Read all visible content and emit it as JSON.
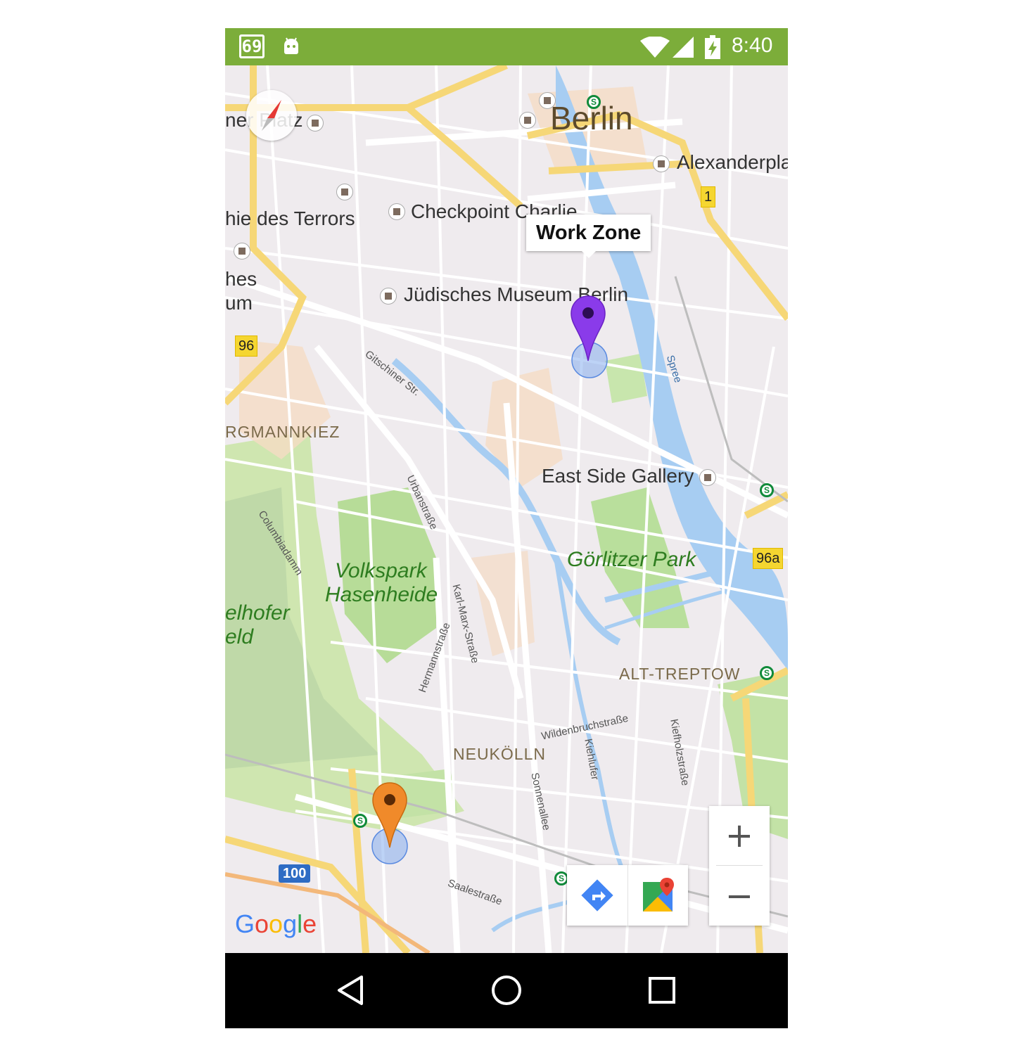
{
  "status_bar": {
    "notification_number": "69",
    "time": "8:40",
    "color": "#7cad3a"
  },
  "map": {
    "city_label": "Berlin",
    "poi_labels": {
      "alexanderplatz": "Alexanderpla",
      "checkpoint_charlie": "Checkpoint Charlie",
      "topographie": "hie des Terrors",
      "juedisches_museum": "Jüdisches Museum Berlin",
      "east_side_gallery": "East Side Gallery",
      "platz": "ner Platz",
      "hes": "hes",
      "um": "um"
    },
    "park_labels": {
      "volkspark_line1": "Volkspark",
      "volkspark_line2": "Hasenheide",
      "goerlitzer": "Görlitzer Park",
      "tempelhofer_line1": "elhofer",
      "tempelhofer_line2": "eld"
    },
    "district_labels": {
      "bergmannkiez": "RGMANNKIEZ",
      "alt_treptow": "ALT-TREPTOW",
      "neukoelln": "NEUKÖLLN"
    },
    "street_labels": {
      "gitschiner": "Gitschiner Str.",
      "spree": "Spree",
      "urbanstrasse": "Urbanstraße",
      "columbiadamm": "Columbiadamm",
      "hermannstrasse": "Hermannstraße",
      "karl_marx": "Karl-Marx-Straße",
      "wildenbruch": "Wildenbruchstraße",
      "kiehlufer": "Kiehlufer",
      "kiefholz": "Kiefholzstraße",
      "sonnenallee": "Sonnenallee",
      "saalestrasse": "Saalestraße"
    },
    "road_shields": {
      "r1": "1",
      "r96": "96",
      "r96a": "96a",
      "r100": "100"
    },
    "markers": [
      {
        "name": "work",
        "color": "#8a3bea",
        "info_window": "Work Zone"
      },
      {
        "name": "home",
        "color": "#f08a2a"
      }
    ],
    "brand": "Google",
    "controls": {
      "zoom_in": "+",
      "zoom_out": "−",
      "directions_icon": "directions-icon",
      "open_maps_icon": "google-maps-icon",
      "compass_icon": "compass-icon"
    }
  },
  "nav_bar": {
    "back_icon": "back-icon",
    "home_icon": "home-icon",
    "recents_icon": "recents-icon"
  }
}
